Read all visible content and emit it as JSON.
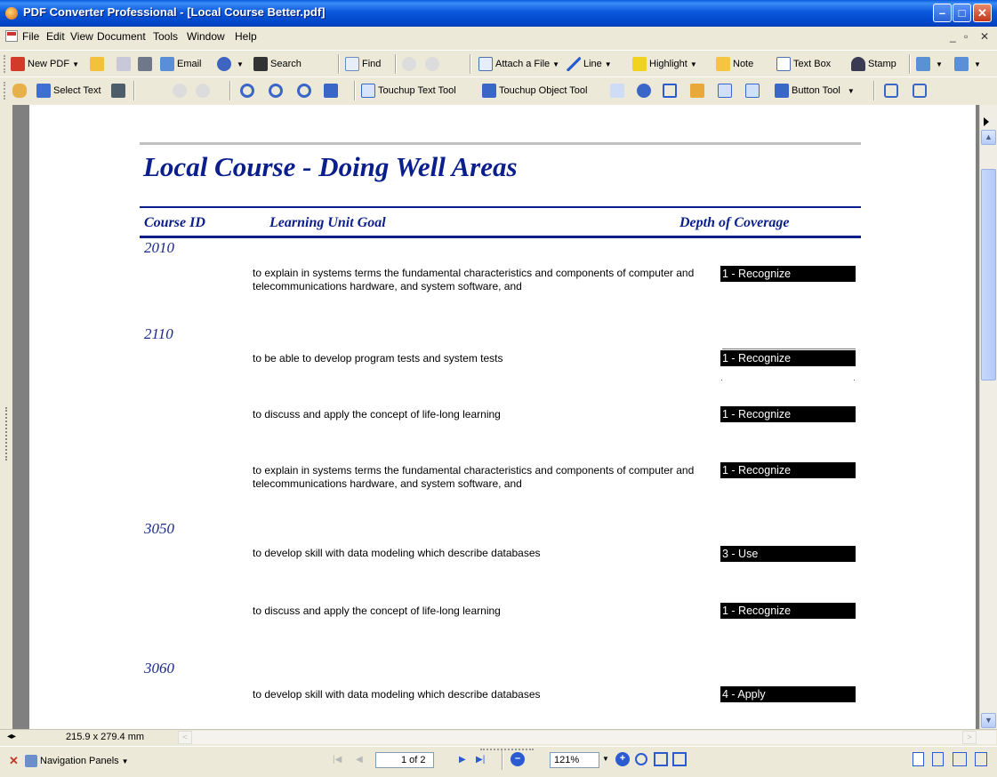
{
  "window": {
    "title": "PDF Converter Professional - [Local Course Better.pdf]"
  },
  "menu": [
    "File",
    "Edit",
    "View",
    "Document",
    "Tools",
    "Window",
    "Help"
  ],
  "toolbar1": {
    "new_pdf": "New PDF",
    "email": "Email",
    "search": "Search",
    "find": "Find",
    "attach": "Attach a File",
    "line": "Line",
    "highlight": "Highlight",
    "note": "Note",
    "text_box": "Text Box",
    "stamp": "Stamp"
  },
  "toolbar2": {
    "select_text": "Select Text",
    "touchup_text": "Touchup Text Tool",
    "touchup_object": "Touchup Object Tool",
    "button_tool": "Button Tool"
  },
  "document": {
    "heading": "Local Course - Doing Well Areas",
    "columns": {
      "course_id": "Course ID",
      "goal": "Learning Unit Goal",
      "depth": "Depth of Coverage"
    },
    "rows": [
      {
        "course": "2010",
        "goal": "to explain in systems terms the fundamental characteristics and components of computer and telecommunications hardware, and system software, and",
        "depth": "1 - Recognize"
      },
      {
        "course": "2110",
        "goal": "to be able to develop program tests and system tests",
        "depth": "1 - Recognize"
      },
      {
        "course": "",
        "goal": "to discuss and apply the concept of life-long learning",
        "depth": "1 - Recognize"
      },
      {
        "course": "",
        "goal": "to explain in systems terms the fundamental characteristics and components of computer and telecommunications hardware, and system software, and",
        "depth": "1 - Recognize"
      },
      {
        "course": "3050",
        "goal": "to develop skill with data modeling which describe databases",
        "depth": "3 - Use"
      },
      {
        "course": "",
        "goal": "to discuss and apply the concept of life-long learning",
        "depth": "1 - Recognize"
      },
      {
        "course": "3060",
        "goal": "to develop skill with data modeling which describe databases",
        "depth": "4 - Apply"
      }
    ]
  },
  "status": {
    "page_size": "215.9 x 279.4 mm",
    "nav_panels": "Navigation Panels",
    "page_indicator": "1 of 2",
    "zoom": "121%"
  }
}
